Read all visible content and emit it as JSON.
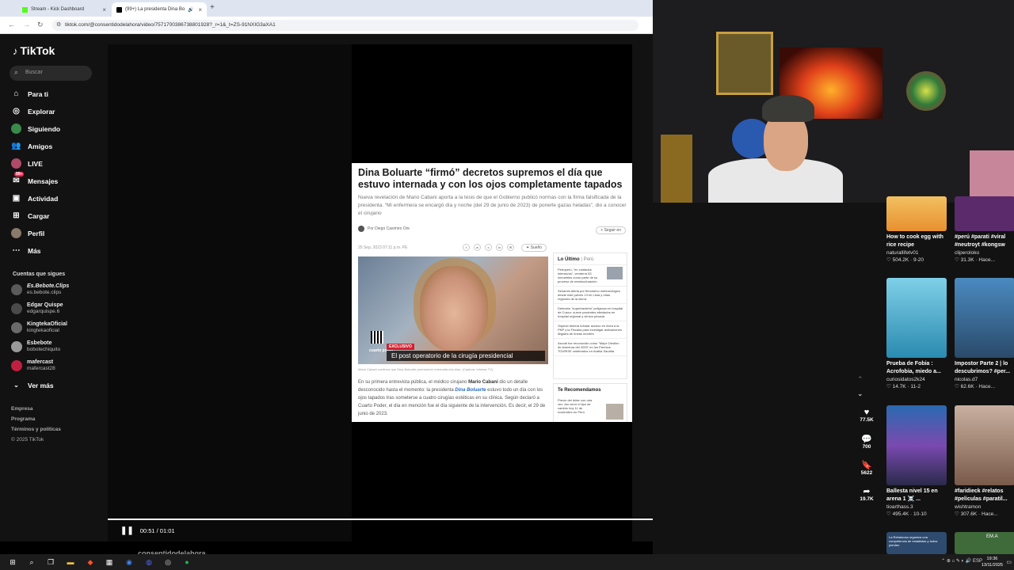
{
  "browser": {
    "tabs": [
      {
        "label": "Stream - Kick Dashboard",
        "close": "×"
      },
      {
        "label": "(99+) La presidenta Dina Bo",
        "close": "×"
      }
    ],
    "new_tab": "+",
    "url": "tiktok.com/@consentidodelahora/video/7571700386738801928?_r=1&_t=ZS-91NXIG3aXA1"
  },
  "tiktok": {
    "logo": "TikTok",
    "search_placeholder": "Buscar",
    "nav": [
      {
        "label": "Para ti",
        "icon": "home-icon"
      },
      {
        "label": "Explorar",
        "icon": "compass-icon"
      },
      {
        "label": "Siguiendo",
        "icon": "following-icon"
      },
      {
        "label": "Amigos",
        "icon": "friends-icon"
      },
      {
        "label": "LIVE",
        "icon": "live-icon"
      },
      {
        "label": "Mensajes",
        "icon": "messages-icon",
        "badge": "99+"
      },
      {
        "label": "Actividad",
        "icon": "activity-icon"
      },
      {
        "label": "Cargar",
        "icon": "upload-icon"
      },
      {
        "label": "Perfil",
        "icon": "profile-icon"
      },
      {
        "label": "Más",
        "icon": "more-icon"
      }
    ],
    "following_header": "Cuentas que sigues",
    "following": [
      {
        "name": "Es.Bebote.Clips",
        "user": "es.bebote.clips"
      },
      {
        "name": "Edgar Quispe",
        "user": "edgarquispe.6"
      },
      {
        "name": "KingtekaOficial",
        "user": "kingtekaoficial"
      },
      {
        "name": "Esbebote",
        "user": "bobotechiquito"
      },
      {
        "name": "mafercast",
        "user": "mafercast28"
      }
    ],
    "see_more": "Ver más",
    "footer": [
      "Empresa",
      "Programa",
      "Términos y políticas",
      "© 2025 TikTok"
    ],
    "video": {
      "time": "00:51 / 01:01",
      "progress": 0.83,
      "handle": "consentidodelahora"
    },
    "article": {
      "headline": "Dina Boluarte “firmó” decretos supremos el día que estuvo internada y con los ojos completamente tapados",
      "deck": "Nueva revelación de Mario Cabani aporta a la tesis de que el Gobierno publicó normas con la firma falsificada de la presidenta. “Mi enfermera se encargó día y noche (del 29 de junio de 2023) de ponerle gazas heladas”, dio a conocer el cirujano",
      "byline": "Por Diego Casimiro Ore",
      "follow": "+ Seguir en",
      "date": "20 Sep, 2023 07:11 p.m. PE",
      "suggest": "Sueño",
      "exclusive": "EXCLUSIVO",
      "caption": "El post operatorio de la cirugía presidencial",
      "brand": "cuarto poder",
      "photo_caption": "Mario Cabani confirmó que Dina Boluarte permaneció internada dos días. (Captura: Infobae TV)",
      "body_1": "En su primera entrevista pública, el médico cirujano ",
      "body_name": "Mario Cabani",
      "body_2": " dio un detalle desconocido hasta el momento: la presidenta ",
      "body_link": "Dina Boluarte",
      "body_3": " estuvo todo un día con los ojos tapados tras someterse a cuatro cirugías estéticas en su clínica. Según declaró a Cuarto Poder, el día en mención fue el día siguiente de la intervención. Es decir, el 29 de junio de 2023.",
      "latest_header": "Lo Último",
      "latest_tag": "Perú",
      "latest": [
        "Petroperú, \"en cuidados intensivos\", vendería 53 inmuebles como parte de su proceso de reestructuración",
        "Senamhi alerta por fenómeno meteorológico desde este jueves 13 en Lima y otras regiones de la sierra",
        "Detectan \"superbacteria\" peligrosa en hospital de Cusco: nueve pacientes afectados en hospital regional y clínica privada",
        "Ospinel deberá brindar acceso en línea a la PNP y la Fiscalía para investigar activaciones ilegales de líneas móviles",
        "Ascodi fue reconocido como \"Mejor Destino de Aventura del 2025\" en los Premios TOURISE celebrados en Arabia Saudita"
      ],
      "rec_header": "Te Recomendamos",
      "rec_item": "Precio del dólar con otra vez. Así cerró el tipo de cambio hoy 11 de noviembre en Perú"
    },
    "actions": [
      {
        "icon": "heart-icon",
        "count": "77.5K"
      },
      {
        "icon": "comment-icon",
        "count": "700"
      },
      {
        "icon": "bookmark-icon",
        "count": "5622"
      },
      {
        "icon": "share-icon",
        "count": "19.7K"
      }
    ],
    "cards": [
      {
        "title": "How to cook egg with rice recipe",
        "user": "naturallifetv01",
        "likes": "504.2K",
        "date": "9-20",
        "color": "#e8a030"
      },
      {
        "title": "#perú #parati #viral #neutroyt #kongsw",
        "user": "cliperoloko",
        "likes": "31.3K",
        "date": "Hace...",
        "color": "#5a2a6a"
      },
      {
        "title": "Prueba de Fobia : Acrofobia, miedo a...",
        "user": "curiosidatos2k24",
        "likes": "14.7K",
        "date": "11-2",
        "color": "#3fa9c9",
        "overlay": "Prueba de Fobia: Acrofobia"
      },
      {
        "title": "Impostor Parte 2 | lo descubrimos? #per...",
        "user": "nicolas.d7",
        "likes": "62.6K",
        "date": "Hace...",
        "color": "#3a7ea8",
        "overlay": "Impostor"
      },
      {
        "title": "Ballesta nivel 15 en arena 1 ☠️ ...",
        "user": "tioarthass.3",
        "likes": "495.4K",
        "date": "10-10",
        "color": "#5a3e8a"
      },
      {
        "title": "#faridieck #relatos #peliculas #paratil...",
        "user": "wishtramon",
        "likes": "307.6K",
        "date": "Hace...",
        "color": "#6a5040"
      },
      {
        "title": "",
        "user": "",
        "likes": "",
        "date": "",
        "color": "#2e4a6e",
        "overlay": "La Rebaloosa organiza una competencia de estadistas y todos pierden"
      },
      {
        "title": "",
        "user": "",
        "likes": "",
        "date": "",
        "color": "#3f6a3a",
        "overlay": "EM.A"
      }
    ]
  },
  "taskbar": {
    "lang": "ESP",
    "time": "19:36",
    "date": "13/11/2025"
  }
}
